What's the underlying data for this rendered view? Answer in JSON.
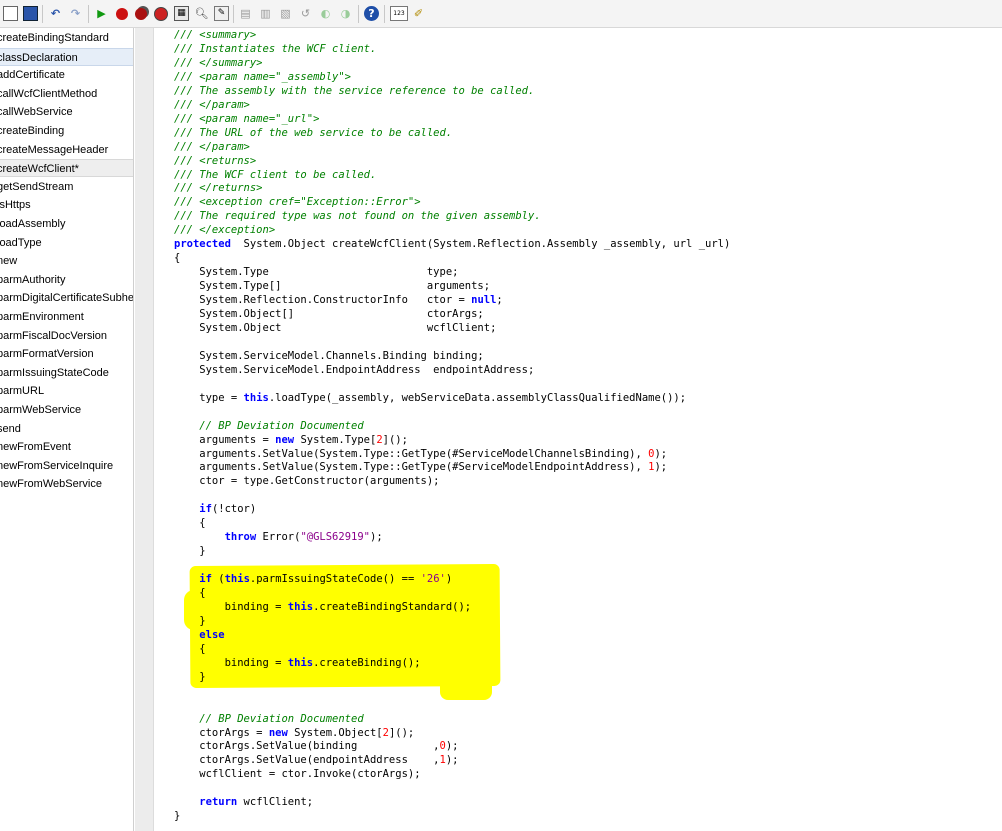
{
  "toolbar": {
    "icons": [
      "new-file",
      "save",
      "undo",
      "redo",
      "run",
      "breakpoint",
      "stop",
      "toggle-breakpoint",
      "compile",
      "find",
      "lookup",
      "comment",
      "uncomment",
      "indent",
      "back",
      "forward",
      "refresh",
      "help",
      "line-numbers",
      "tools"
    ],
    "bp_color": "#cc1111",
    "run_color": "#109910"
  },
  "sidebar": {
    "items": [
      "createBindingStandard",
      "classDeclaration",
      "addCertificate",
      "callWcfClientMethod",
      "callWebService",
      "createBinding",
      "createMessageHeader",
      "createWcfClient*",
      "getSendStream",
      "isHttps",
      "loadAssembly",
      "loadType",
      "new",
      "parmAuthority",
      "parmDigitalCertificateSubhect",
      "parmEnvironment",
      "parmFiscalDocVersion",
      "parmFormatVersion",
      "parmIssuingStateCode",
      "parmURL",
      "parmWebService",
      "send",
      "newFromEvent",
      "newFromServiceInquire",
      "newFromWebService"
    ],
    "selected_index": 1,
    "modified_index": 7
  },
  "code": {
    "highlight_color": "#ffff00",
    "lines": [
      [
        [
          "cm",
          "/// <summary>"
        ]
      ],
      [
        [
          "cm",
          "/// Instantiates the WCF client."
        ]
      ],
      [
        [
          "cm",
          "/// </summary>"
        ]
      ],
      [
        [
          "cm",
          "/// <param name=\"_assembly\">"
        ]
      ],
      [
        [
          "cm",
          "/// The assembly with the service reference to be called."
        ]
      ],
      [
        [
          "cm",
          "/// </param>"
        ]
      ],
      [
        [
          "cm",
          "/// <param name=\"_url\">"
        ]
      ],
      [
        [
          "cm",
          "/// The URL of the web service to be called."
        ]
      ],
      [
        [
          "cm",
          "/// </param>"
        ]
      ],
      [
        [
          "cm",
          "/// <returns>"
        ]
      ],
      [
        [
          "cm",
          "/// The WCF client to be called."
        ]
      ],
      [
        [
          "cm",
          "/// </returns>"
        ]
      ],
      [
        [
          "cm",
          "/// <exception cref=\"Exception::Error\">"
        ]
      ],
      [
        [
          "cm",
          "/// The required type was not found on the given assembly."
        ]
      ],
      [
        [
          "cm",
          "/// </exception>"
        ]
      ],
      [
        [
          "kw",
          "protected"
        ],
        [
          "",
          "  System.Object createWcfClient(System.Reflection.Assembly _assembly, url _url)"
        ]
      ],
      [
        [
          "",
          "{"
        ]
      ],
      [
        [
          "",
          "    System.Type                         type;"
        ]
      ],
      [
        [
          "",
          "    System.Type[]                       arguments;"
        ]
      ],
      [
        [
          "",
          "    System.Reflection.ConstructorInfo   ctor = "
        ],
        [
          "kw",
          "null"
        ],
        [
          "",
          ";"
        ]
      ],
      [
        [
          "",
          "    System.Object[]                     ctorArgs;"
        ]
      ],
      [
        [
          "",
          "    System.Object                       wcflClient;"
        ]
      ],
      [
        [
          "",
          ""
        ]
      ],
      [
        [
          "",
          "    System.ServiceModel.Channels.Binding binding;"
        ]
      ],
      [
        [
          "",
          "    System.ServiceModel.EndpointAddress  endpointAddress;"
        ]
      ],
      [
        [
          "",
          ""
        ]
      ],
      [
        [
          "",
          "    type = "
        ],
        [
          "kw",
          "this"
        ],
        [
          "",
          ".loadType(_assembly, webServiceData.assemblyClassQualifiedName());"
        ]
      ],
      [
        [
          "",
          ""
        ]
      ],
      [
        [
          "cm",
          "    // BP Deviation Documented"
        ]
      ],
      [
        [
          "",
          "    arguments = "
        ],
        [
          "kw",
          "new"
        ],
        [
          "",
          " System.Type["
        ],
        [
          "num",
          "2"
        ],
        [
          "",
          "]();"
        ]
      ],
      [
        [
          "",
          "    arguments.SetValue(System.Type::GetType(#ServiceModelChannelsBinding), "
        ],
        [
          "num",
          "0"
        ],
        [
          "",
          ");"
        ]
      ],
      [
        [
          "",
          "    arguments.SetValue(System.Type::GetType(#ServiceModelEndpointAddress), "
        ],
        [
          "num",
          "1"
        ],
        [
          "",
          ");"
        ]
      ],
      [
        [
          "",
          "    ctor = type.GetConstructor(arguments);"
        ]
      ],
      [
        [
          "",
          ""
        ]
      ],
      [
        [
          "",
          "    "
        ],
        [
          "kw",
          "if"
        ],
        [
          "",
          "(!ctor)"
        ]
      ],
      [
        [
          "",
          "    {"
        ]
      ],
      [
        [
          "",
          "        "
        ],
        [
          "kw",
          "throw"
        ],
        [
          "",
          " Error("
        ],
        [
          "str",
          "\"@GLS62919\""
        ],
        [
          "",
          ");"
        ]
      ],
      [
        [
          "",
          "    }"
        ]
      ],
      [
        [
          "",
          ""
        ]
      ],
      [
        [
          "",
          "    "
        ],
        [
          "kw",
          "if"
        ],
        [
          "",
          " ("
        ],
        [
          "kw",
          "this"
        ],
        [
          "",
          ".parmIssuingStateCode() == "
        ],
        [
          "str",
          "'26'"
        ],
        [
          "",
          ")"
        ]
      ],
      [
        [
          "",
          "    {"
        ]
      ],
      [
        [
          "",
          "        binding = "
        ],
        [
          "kw",
          "this"
        ],
        [
          "",
          ".createBindingStandard();"
        ]
      ],
      [
        [
          "",
          "    }"
        ]
      ],
      [
        [
          "",
          "    "
        ],
        [
          "kw",
          "else"
        ]
      ],
      [
        [
          "",
          "    {"
        ]
      ],
      [
        [
          "",
          "        binding = "
        ],
        [
          "kw",
          "this"
        ],
        [
          "",
          ".createBinding();"
        ]
      ],
      [
        [
          "",
          "    }"
        ]
      ],
      [
        [
          "",
          ""
        ]
      ],
      [
        [
          "",
          ""
        ]
      ],
      [
        [
          "cm",
          "    // BP Deviation Documented"
        ]
      ],
      [
        [
          "",
          "    ctorArgs = "
        ],
        [
          "kw",
          "new"
        ],
        [
          "",
          " System.Object["
        ],
        [
          "num",
          "2"
        ],
        [
          "",
          "]();"
        ]
      ],
      [
        [
          "",
          "    ctorArgs.SetValue(binding            ,"
        ],
        [
          "num",
          "0"
        ],
        [
          "",
          ");"
        ]
      ],
      [
        [
          "",
          "    ctorArgs.SetValue(endpointAddress    ,"
        ],
        [
          "num",
          "1"
        ],
        [
          "",
          ");"
        ]
      ],
      [
        [
          "",
          "    wcflClient = ctor.Invoke(ctorArgs);"
        ]
      ],
      [
        [
          "",
          ""
        ]
      ],
      [
        [
          "",
          "    "
        ],
        [
          "kw",
          "return"
        ],
        [
          "",
          " wcflClient;"
        ]
      ],
      [
        [
          "",
          "}"
        ]
      ]
    ]
  }
}
